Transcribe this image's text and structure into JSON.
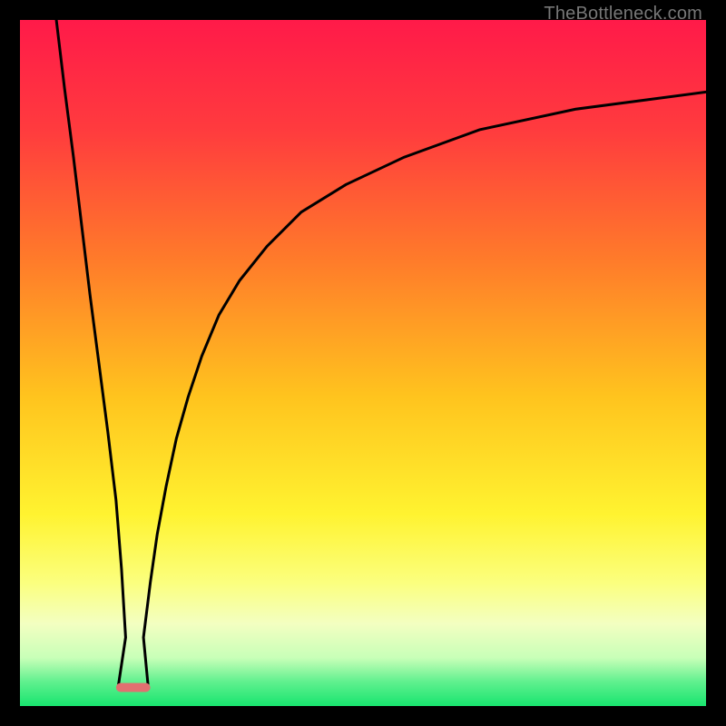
{
  "watermark": "TheBottleneck.com",
  "chart_data": {
    "type": "line",
    "title": "",
    "xlabel": "",
    "ylabel": "",
    "xlim": [
      0,
      100
    ],
    "ylim": [
      0,
      100
    ],
    "grid": false,
    "legend": false,
    "background_gradient": {
      "stops": [
        {
          "offset": 0.0,
          "color": "#ff1a49"
        },
        {
          "offset": 0.16,
          "color": "#ff3b3e"
        },
        {
          "offset": 0.35,
          "color": "#ff7b2a"
        },
        {
          "offset": 0.55,
          "color": "#ffc41e"
        },
        {
          "offset": 0.72,
          "color": "#fff330"
        },
        {
          "offset": 0.82,
          "color": "#fbff7e"
        },
        {
          "offset": 0.88,
          "color": "#f3ffc1"
        },
        {
          "offset": 0.93,
          "color": "#c8ffb8"
        },
        {
          "offset": 0.965,
          "color": "#5ff08e"
        },
        {
          "offset": 1.0,
          "color": "#18e56f"
        }
      ]
    },
    "marker": {
      "x": 16.5,
      "y_floor": 97.3,
      "width": 5.0,
      "height": 1.3,
      "rx": 0.65,
      "color": "#e17070"
    },
    "series": [
      {
        "name": "left-branch",
        "x": [
          5.3,
          6.5,
          7.8,
          9.0,
          10.2,
          11.5,
          12.8,
          14.0,
          14.8,
          15.4
        ],
        "y": [
          0,
          10,
          20,
          30,
          40,
          50,
          60,
          70,
          80,
          90
        ]
      },
      {
        "name": "right-branch",
        "x": [
          18.0,
          19.0,
          20.0,
          21.3,
          22.8,
          24.5,
          26.5,
          29.0,
          32.0,
          36.0,
          41.0,
          47.5,
          56.0,
          67.0,
          81.0,
          100.0
        ],
        "y": [
          90,
          82,
          75,
          68,
          61,
          55,
          49,
          43,
          38,
          33,
          28,
          24,
          20,
          16,
          13,
          10.5
        ]
      }
    ]
  }
}
